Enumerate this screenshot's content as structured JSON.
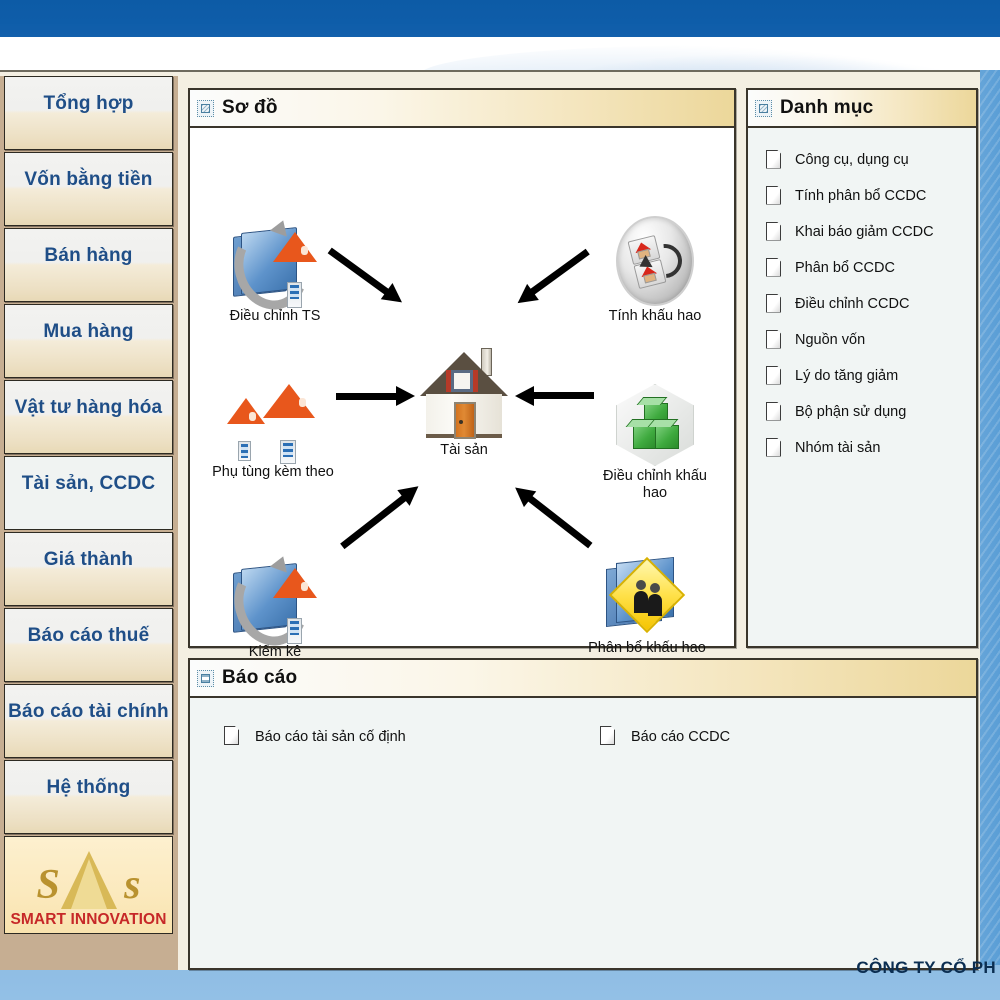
{
  "sidebar": {
    "items": [
      {
        "label": "Tổng hợp",
        "selected": false
      },
      {
        "label": "Vốn bằng tiền",
        "selected": false
      },
      {
        "label": "Bán hàng",
        "selected": false
      },
      {
        "label": "Mua hàng",
        "selected": false
      },
      {
        "label": "Vật tư hàng hóa",
        "selected": false
      },
      {
        "label": "Tài sản, CCDC",
        "selected": true
      },
      {
        "label": "Giá thành",
        "selected": false
      },
      {
        "label": "Báo cáo thuế",
        "selected": false
      },
      {
        "label": "Báo cáo tài chính",
        "selected": false
      },
      {
        "label": "Hệ thống",
        "selected": false
      }
    ],
    "logo_text": "SMART INNOVATION"
  },
  "diagram_panel": {
    "title": "Sơ đồ",
    "icon": "diagram-icon",
    "nodes": [
      {
        "id": "dieu-chinh-ts",
        "label": "Điều chỉnh TS",
        "icon": "folder-house-refresh-icon"
      },
      {
        "id": "tinh-khau-hao",
        "label": "Tính khấu hao",
        "icon": "oval-depreciation-icon"
      },
      {
        "id": "phu-tung-kem-theo",
        "label": "Phụ tùng kèm theo",
        "icon": "two-houses-icon"
      },
      {
        "id": "tai-san",
        "label": "Tài sản",
        "icon": "house-icon"
      },
      {
        "id": "dieu-chinh-khau-hao",
        "label": "Điều chỉnh khấu hao",
        "icon": "green-cubes-icon"
      },
      {
        "id": "kiem-ke",
        "label": "Kiểm kê",
        "icon": "folder-house-refresh-icon"
      },
      {
        "id": "phan-bo-khau-hao",
        "label": "Phân bổ khấu hao",
        "icon": "yellow-sign-people-icon"
      }
    ]
  },
  "category_panel": {
    "title": "Danh mục",
    "icon": "catalog-icon",
    "items": [
      {
        "label": "Công cụ, dụng cụ"
      },
      {
        "label": "Tính phân bổ CCDC"
      },
      {
        "label": "Khai báo giảm CCDC"
      },
      {
        "label": "Phân bổ CCDC"
      },
      {
        "label": "Điều chỉnh CCDC"
      },
      {
        "label": "Nguồn vốn"
      },
      {
        "label": "Lý do tăng giảm"
      },
      {
        "label": "Bộ phận sử dụng"
      },
      {
        "label": "Nhóm tài sản"
      }
    ]
  },
  "report_panel": {
    "title": "Báo cáo",
    "icon": "report-icon",
    "items": [
      {
        "label": "Báo cáo tài sản cố định"
      },
      {
        "label": "Báo cáo CCDC"
      }
    ]
  },
  "footer": {
    "company": "CÔNG TY CỔ PH",
    "sub": ""
  },
  "colors": {
    "accent_blue": "#1f4e87",
    "sidebar_bg": "#c6ae92",
    "header_gold": "#ecd79a",
    "logo_red": "#c62828"
  }
}
